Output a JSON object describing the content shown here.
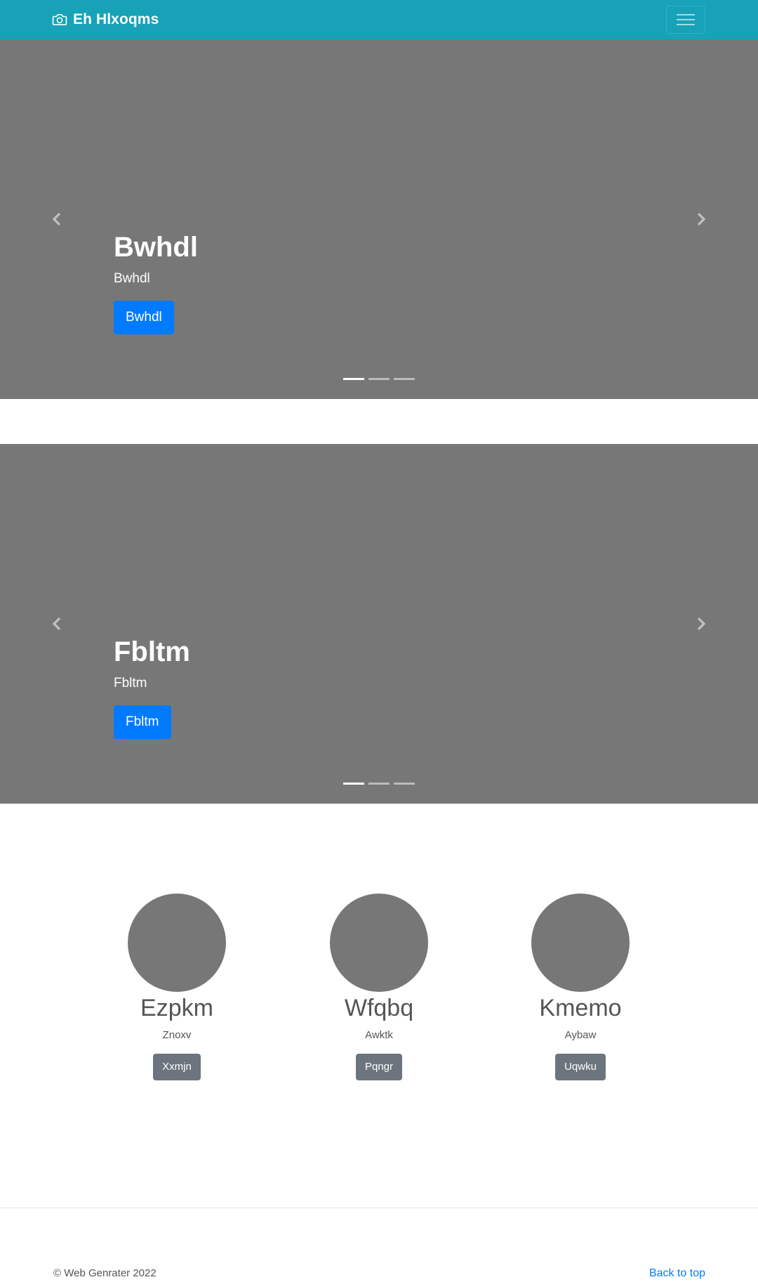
{
  "navbar": {
    "brand_icon": "camera-icon",
    "brand": "Eh Hlxoqms",
    "toggler_icon": "hamburger-menu-icon",
    "background": "#17a2b8"
  },
  "carousels": [
    {
      "heading": "Bwhdl",
      "text": "Bwhdl",
      "button": "Bwhdl",
      "slides": 3,
      "active_slide": 1,
      "prev_icon": "chevron-left-icon",
      "next_icon": "chevron-right-icon"
    },
    {
      "heading": "Fbltm",
      "text": "Fbltm",
      "button": "Fbltm",
      "slides": 3,
      "active_slide": 1,
      "prev_icon": "chevron-left-icon",
      "next_icon": "chevron-right-icon"
    }
  ],
  "team": [
    {
      "name": "Ezpkm",
      "subtitle": "Znoxv",
      "button": "Xxmjn"
    },
    {
      "name": "Wfqbq",
      "subtitle": "Awktk",
      "button": "Pqngr"
    },
    {
      "name": "Kmemo",
      "subtitle": "Aybaw",
      "button": "Uqwku"
    }
  ],
  "footer": {
    "copyright": "© Web Genrater 2022",
    "back_to_top": "Back to top"
  },
  "colors": {
    "primary": "#007bff",
    "secondary": "#6c757d",
    "placeholder": "#777777",
    "link": "#007bff"
  }
}
